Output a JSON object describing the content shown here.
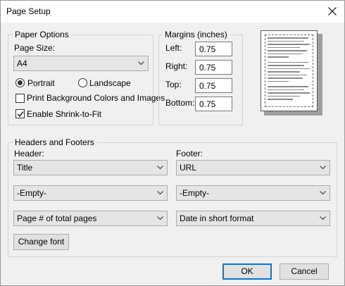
{
  "window": {
    "title": "Page Setup"
  },
  "paper_options": {
    "group_label": "Paper Options",
    "page_size_label": "Page Size:",
    "page_size_value": "A4",
    "portrait_label": "Portrait",
    "landscape_label": "Landscape",
    "orientation_selected": "Portrait",
    "print_background_label": "Print Background Colors and Images",
    "print_background_checked": false,
    "shrink_to_fit_label": "Enable Shrink-to-Fit",
    "shrink_to_fit_checked": true
  },
  "margins": {
    "group_label": "Margins (inches)",
    "left_label": "Left:",
    "left_value": "0.75",
    "right_label": "Right:",
    "right_value": "0.75",
    "top_label": "Top:",
    "top_value": "0.75",
    "bottom_label": "Bottom:",
    "bottom_value": "0.75"
  },
  "headers_footers": {
    "group_label": "Headers and Footers",
    "header_label": "Header:",
    "footer_label": "Footer:",
    "header_rows": [
      "Title",
      "-Empty-",
      "Page # of total pages"
    ],
    "footer_rows": [
      "URL",
      "-Empty-",
      "Date in short format"
    ],
    "change_font_label": "Change font"
  },
  "buttons": {
    "ok_label": "OK",
    "cancel_label": "Cancel"
  }
}
